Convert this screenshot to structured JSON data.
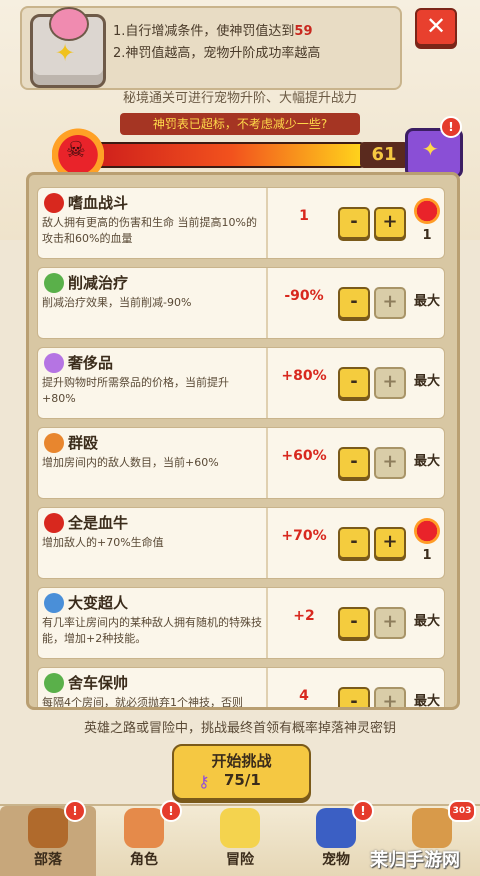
{
  "header": {
    "rule_1_prefix": "1.自行增减条件，使神罚值达到",
    "rule_1_value": "59",
    "rule_2": "2.神罚值越高，宠物升阶成功率越高",
    "close_label": "✕",
    "subtitle": "秘境通关可进行宠物升阶、大幅提升战力",
    "warning": "神罚表已超标，不考虑减少一些?",
    "bar_value": "61",
    "bar_fill_percent": 100,
    "gift_alert": "!"
  },
  "conditions": [
    {
      "title": "嗜血战斗",
      "icon": "fire-skull-icon",
      "icon_color": "#d8281e",
      "desc": "敌人拥有更高的伤害和生命\n当前提高10%的攻击和60%的血量",
      "value": "1",
      "minus": "-",
      "plus": "+",
      "status": "1",
      "status_type": "icon",
      "plus_disabled": false
    },
    {
      "title": "削减治疗",
      "icon": "leaf-icon",
      "icon_color": "#5ab04a",
      "desc": "削减治疗效果，当前削减-90%",
      "value": "-90%",
      "minus": "-",
      "plus": "+",
      "status": "最大",
      "status_type": "text",
      "plus_disabled": true
    },
    {
      "title": "奢侈品",
      "icon": "jewel-icon",
      "icon_color": "#b574e3",
      "desc": "提升购物时所需祭品的价格，当前提升+80%",
      "value": "+80%",
      "minus": "-",
      "plus": "+",
      "status": "最大",
      "status_type": "text",
      "plus_disabled": true
    },
    {
      "title": "群殴",
      "icon": "crowd-icon",
      "icon_color": "#e8862e",
      "desc": "增加房间内的敌人数目，当前+60%",
      "value": "+60%",
      "minus": "-",
      "plus": "+",
      "status": "最大",
      "status_type": "text",
      "plus_disabled": true
    },
    {
      "title": "全是血牛",
      "icon": "monster-icon",
      "icon_color": "#d8281e",
      "desc": "增加敌人的+70%生命值",
      "value": "+70%",
      "minus": "-",
      "plus": "+",
      "status": "1",
      "status_type": "icon",
      "plus_disabled": false
    },
    {
      "title": "大变超人",
      "icon": "flask-icon",
      "icon_color": "#4a8fd8",
      "desc": "有几率让房间内的某种敌人拥有随机的特殊技能，增加+2种技能。",
      "value": "+2",
      "minus": "-",
      "plus": "+",
      "status": "最大",
      "status_type": "text",
      "plus_disabled": true
    },
    {
      "title": "舍车保帅",
      "icon": "cup-icon",
      "icon_color": "#5ab04a",
      "desc": "每隔4个房间，就必须抛弃1个神技，否则",
      "value": "4",
      "minus": "-",
      "plus": "+",
      "status": "最大",
      "status_type": "text",
      "plus_disabled": true
    }
  ],
  "footer": {
    "hint": "英雄之路或冒险中，挑战最终首领有概率掉落神灵密钥",
    "start_label": "开始挑战",
    "progress": "75/1"
  },
  "nav": [
    {
      "label": "部落",
      "icon": "tribe-icon",
      "alert": "!"
    },
    {
      "label": "角色",
      "icon": "hero-icon",
      "alert": "!"
    },
    {
      "label": "冒险",
      "icon": "map-icon",
      "alert": ""
    },
    {
      "label": "宠物",
      "icon": "pet-icon",
      "alert": "!"
    },
    {
      "label": "",
      "icon": "shop-icon",
      "alert": "303"
    }
  ],
  "watermark": "茉归手游网"
}
